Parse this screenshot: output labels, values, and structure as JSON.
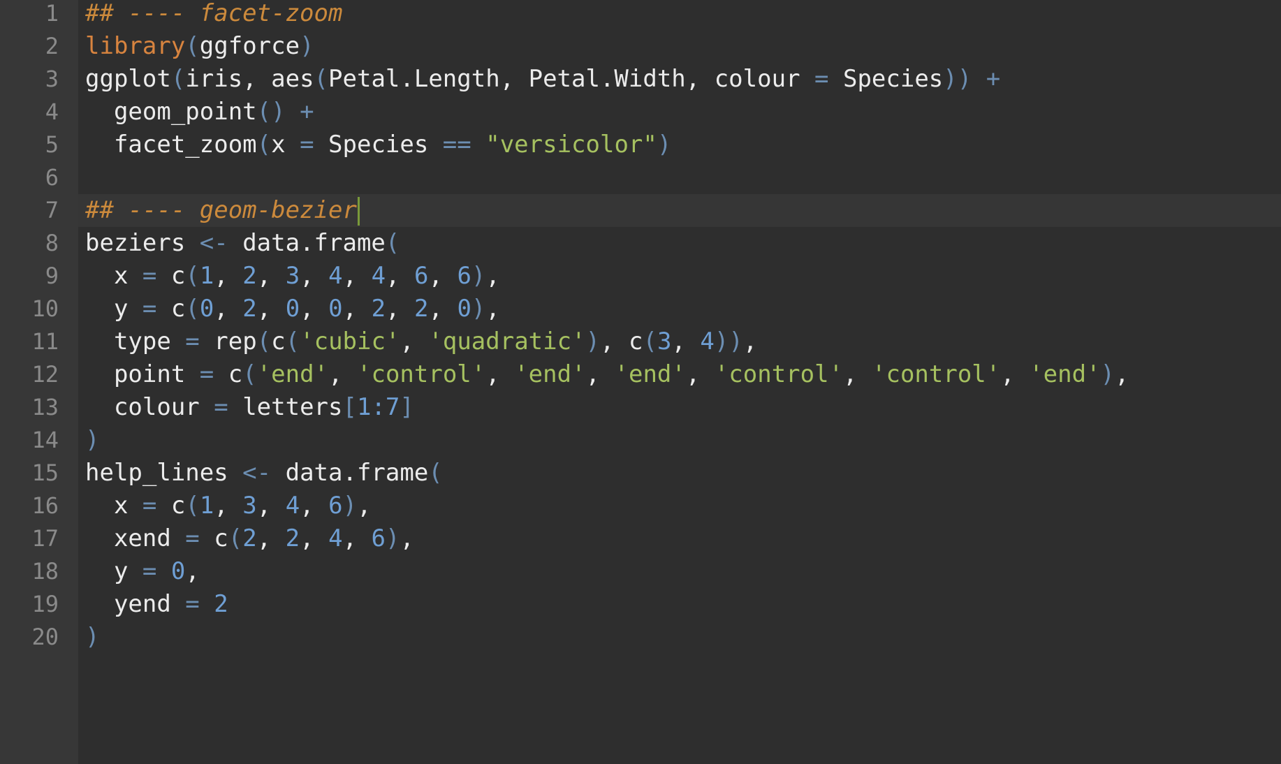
{
  "editor": {
    "theme_colors": {
      "background": "#2e2e2e",
      "gutter": "#373737",
      "line_number": "#8a8a8a",
      "text": "#ececec",
      "comment": "#cc8a3c",
      "function": "#d8843f",
      "punctuation": "#6c8eb2",
      "number": "#6f9fd4",
      "string": "#a6c160",
      "cursor": "#7a9a3a"
    },
    "active_line": 7,
    "lines": [
      {
        "number": "1",
        "tokens": [
          {
            "t": "## ---- facet-zoom",
            "k": "comment"
          }
        ]
      },
      {
        "number": "2",
        "tokens": [
          {
            "t": "library",
            "k": "func"
          },
          {
            "t": "(",
            "k": "punct"
          },
          {
            "t": "ggforce",
            "k": "plain"
          },
          {
            "t": ")",
            "k": "punct"
          }
        ]
      },
      {
        "number": "3",
        "tokens": [
          {
            "t": "ggplot",
            "k": "plain"
          },
          {
            "t": "(",
            "k": "punct"
          },
          {
            "t": "iris, aes",
            "k": "plain"
          },
          {
            "t": "(",
            "k": "punct"
          },
          {
            "t": "Petal.Length, Petal.Width, colour ",
            "k": "plain"
          },
          {
            "t": "=",
            "k": "op"
          },
          {
            "t": " Species",
            "k": "plain"
          },
          {
            "t": "))",
            "k": "punct"
          },
          {
            "t": " +",
            "k": "op"
          }
        ]
      },
      {
        "number": "4",
        "tokens": [
          {
            "t": "  geom_point",
            "k": "plain"
          },
          {
            "t": "()",
            "k": "punct"
          },
          {
            "t": " +",
            "k": "op"
          }
        ]
      },
      {
        "number": "5",
        "tokens": [
          {
            "t": "  facet_zoom",
            "k": "plain"
          },
          {
            "t": "(",
            "k": "punct"
          },
          {
            "t": "x ",
            "k": "plain"
          },
          {
            "t": "=",
            "k": "op"
          },
          {
            "t": " Species ",
            "k": "plain"
          },
          {
            "t": "==",
            "k": "op"
          },
          {
            "t": " ",
            "k": "plain"
          },
          {
            "t": "\"versicolor\"",
            "k": "str"
          },
          {
            "t": ")",
            "k": "punct"
          }
        ]
      },
      {
        "number": "6",
        "tokens": []
      },
      {
        "number": "7",
        "tokens": [
          {
            "t": "## ---- geom-bezier",
            "k": "comment"
          }
        ],
        "cursor": true
      },
      {
        "number": "8",
        "tokens": [
          {
            "t": "beziers ",
            "k": "plain"
          },
          {
            "t": "<-",
            "k": "op"
          },
          {
            "t": " data.frame",
            "k": "plain"
          },
          {
            "t": "(",
            "k": "punct"
          }
        ]
      },
      {
        "number": "9",
        "tokens": [
          {
            "t": "  x ",
            "k": "plain"
          },
          {
            "t": "=",
            "k": "op"
          },
          {
            "t": " c",
            "k": "plain"
          },
          {
            "t": "(",
            "k": "punct"
          },
          {
            "t": "1",
            "k": "num"
          },
          {
            "t": ", ",
            "k": "plain"
          },
          {
            "t": "2",
            "k": "num"
          },
          {
            "t": ", ",
            "k": "plain"
          },
          {
            "t": "3",
            "k": "num"
          },
          {
            "t": ", ",
            "k": "plain"
          },
          {
            "t": "4",
            "k": "num"
          },
          {
            "t": ", ",
            "k": "plain"
          },
          {
            "t": "4",
            "k": "num"
          },
          {
            "t": ", ",
            "k": "plain"
          },
          {
            "t": "6",
            "k": "num"
          },
          {
            "t": ", ",
            "k": "plain"
          },
          {
            "t": "6",
            "k": "num"
          },
          {
            "t": ")",
            "k": "punct"
          },
          {
            "t": ",",
            "k": "plain"
          }
        ]
      },
      {
        "number": "10",
        "tokens": [
          {
            "t": "  y ",
            "k": "plain"
          },
          {
            "t": "=",
            "k": "op"
          },
          {
            "t": " c",
            "k": "plain"
          },
          {
            "t": "(",
            "k": "punct"
          },
          {
            "t": "0",
            "k": "num"
          },
          {
            "t": ", ",
            "k": "plain"
          },
          {
            "t": "2",
            "k": "num"
          },
          {
            "t": ", ",
            "k": "plain"
          },
          {
            "t": "0",
            "k": "num"
          },
          {
            "t": ", ",
            "k": "plain"
          },
          {
            "t": "0",
            "k": "num"
          },
          {
            "t": ", ",
            "k": "plain"
          },
          {
            "t": "2",
            "k": "num"
          },
          {
            "t": ", ",
            "k": "plain"
          },
          {
            "t": "2",
            "k": "num"
          },
          {
            "t": ", ",
            "k": "plain"
          },
          {
            "t": "0",
            "k": "num"
          },
          {
            "t": ")",
            "k": "punct"
          },
          {
            "t": ",",
            "k": "plain"
          }
        ]
      },
      {
        "number": "11",
        "tokens": [
          {
            "t": "  type ",
            "k": "plain"
          },
          {
            "t": "=",
            "k": "op"
          },
          {
            "t": " rep",
            "k": "plain"
          },
          {
            "t": "(",
            "k": "punct"
          },
          {
            "t": "c",
            "k": "plain"
          },
          {
            "t": "(",
            "k": "punct"
          },
          {
            "t": "'cubic'",
            "k": "str"
          },
          {
            "t": ", ",
            "k": "plain"
          },
          {
            "t": "'quadratic'",
            "k": "str"
          },
          {
            "t": ")",
            "k": "punct"
          },
          {
            "t": ", c",
            "k": "plain"
          },
          {
            "t": "(",
            "k": "punct"
          },
          {
            "t": "3",
            "k": "num"
          },
          {
            "t": ", ",
            "k": "plain"
          },
          {
            "t": "4",
            "k": "num"
          },
          {
            "t": "))",
            "k": "punct"
          },
          {
            "t": ",",
            "k": "plain"
          }
        ]
      },
      {
        "number": "12",
        "tokens": [
          {
            "t": "  point ",
            "k": "plain"
          },
          {
            "t": "=",
            "k": "op"
          },
          {
            "t": " c",
            "k": "plain"
          },
          {
            "t": "(",
            "k": "punct"
          },
          {
            "t": "'end'",
            "k": "str"
          },
          {
            "t": ", ",
            "k": "plain"
          },
          {
            "t": "'control'",
            "k": "str"
          },
          {
            "t": ", ",
            "k": "plain"
          },
          {
            "t": "'end'",
            "k": "str"
          },
          {
            "t": ", ",
            "k": "plain"
          },
          {
            "t": "'end'",
            "k": "str"
          },
          {
            "t": ", ",
            "k": "plain"
          },
          {
            "t": "'control'",
            "k": "str"
          },
          {
            "t": ", ",
            "k": "plain"
          },
          {
            "t": "'control'",
            "k": "str"
          },
          {
            "t": ", ",
            "k": "plain"
          },
          {
            "t": "'end'",
            "k": "str"
          },
          {
            "t": ")",
            "k": "punct"
          },
          {
            "t": ",",
            "k": "plain"
          }
        ]
      },
      {
        "number": "13",
        "tokens": [
          {
            "t": "  colour ",
            "k": "plain"
          },
          {
            "t": "=",
            "k": "op"
          },
          {
            "t": " letters",
            "k": "plain"
          },
          {
            "t": "[",
            "k": "punct"
          },
          {
            "t": "1:7",
            "k": "num"
          },
          {
            "t": "]",
            "k": "punct"
          }
        ]
      },
      {
        "number": "14",
        "tokens": [
          {
            "t": ")",
            "k": "punct"
          }
        ]
      },
      {
        "number": "15",
        "tokens": [
          {
            "t": "help_lines ",
            "k": "plain"
          },
          {
            "t": "<-",
            "k": "op"
          },
          {
            "t": " data.frame",
            "k": "plain"
          },
          {
            "t": "(",
            "k": "punct"
          }
        ]
      },
      {
        "number": "16",
        "tokens": [
          {
            "t": "  x ",
            "k": "plain"
          },
          {
            "t": "=",
            "k": "op"
          },
          {
            "t": " c",
            "k": "plain"
          },
          {
            "t": "(",
            "k": "punct"
          },
          {
            "t": "1",
            "k": "num"
          },
          {
            "t": ", ",
            "k": "plain"
          },
          {
            "t": "3",
            "k": "num"
          },
          {
            "t": ", ",
            "k": "plain"
          },
          {
            "t": "4",
            "k": "num"
          },
          {
            "t": ", ",
            "k": "plain"
          },
          {
            "t": "6",
            "k": "num"
          },
          {
            "t": ")",
            "k": "punct"
          },
          {
            "t": ",",
            "k": "plain"
          }
        ]
      },
      {
        "number": "17",
        "tokens": [
          {
            "t": "  xend ",
            "k": "plain"
          },
          {
            "t": "=",
            "k": "op"
          },
          {
            "t": " c",
            "k": "plain"
          },
          {
            "t": "(",
            "k": "punct"
          },
          {
            "t": "2",
            "k": "num"
          },
          {
            "t": ", ",
            "k": "plain"
          },
          {
            "t": "2",
            "k": "num"
          },
          {
            "t": ", ",
            "k": "plain"
          },
          {
            "t": "4",
            "k": "num"
          },
          {
            "t": ", ",
            "k": "plain"
          },
          {
            "t": "6",
            "k": "num"
          },
          {
            "t": ")",
            "k": "punct"
          },
          {
            "t": ",",
            "k": "plain"
          }
        ]
      },
      {
        "number": "18",
        "tokens": [
          {
            "t": "  y ",
            "k": "plain"
          },
          {
            "t": "=",
            "k": "op"
          },
          {
            "t": " ",
            "k": "plain"
          },
          {
            "t": "0",
            "k": "num"
          },
          {
            "t": ",",
            "k": "plain"
          }
        ]
      },
      {
        "number": "19",
        "tokens": [
          {
            "t": "  yend ",
            "k": "plain"
          },
          {
            "t": "=",
            "k": "op"
          },
          {
            "t": " ",
            "k": "plain"
          },
          {
            "t": "2",
            "k": "num"
          }
        ]
      },
      {
        "number": "20",
        "tokens": [
          {
            "t": ")",
            "k": "punct"
          }
        ]
      }
    ]
  }
}
